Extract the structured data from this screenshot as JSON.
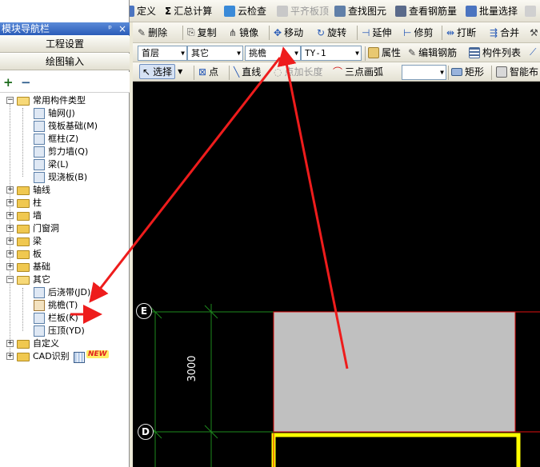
{
  "toolbar1": {
    "items": [
      {
        "label": "定义",
        "icon": "define-icon"
      },
      {
        "label": "汇总计算",
        "icon": "sum-icon"
      },
      {
        "label": "云检查",
        "icon": "cloud-check-icon"
      },
      {
        "label": "平齐板顶",
        "icon": "align-slab-top-icon"
      },
      {
        "label": "查找图元",
        "icon": "find-element-icon"
      },
      {
        "label": "查看钢筋量",
        "icon": "view-rebar-icon"
      },
      {
        "label": "批量选择",
        "icon": "batch-select-icon"
      }
    ]
  },
  "panel": {
    "title": "模块导航栏",
    "pin": "ᵖ",
    "close": "×",
    "btn_project": "工程设置",
    "btn_drawing": "绘图输入"
  },
  "tree": {
    "root": "常用构件类型",
    "common_items": [
      "轴网(J)",
      "筏板基础(M)",
      "框柱(Z)",
      "剪力墙(Q)",
      "梁(L)",
      "现浇板(B)"
    ],
    "groups": [
      "轴线",
      "柱",
      "墙",
      "门窗洞",
      "梁",
      "板",
      "基础"
    ],
    "other_group": "其它",
    "other_items": [
      "后浇带(JD)",
      "挑檐(T)",
      "栏板(K)",
      "压顶(YD)"
    ],
    "tail_groups": [
      "自定义",
      "CAD识别"
    ],
    "new_badge": "NEW"
  },
  "toolbar2": {
    "items": [
      "删除",
      "复制",
      "镜像",
      "移动",
      "旋转",
      "延伸",
      "修剪",
      "打断",
      "合并"
    ]
  },
  "toolbar3": {
    "floor": "首层",
    "category": "其它",
    "type": "挑檐",
    "name": "TY-1",
    "items": [
      "属性",
      "编辑钢筋",
      "构件列表"
    ]
  },
  "toolbar4": {
    "items": [
      "选择",
      "点",
      "直线",
      "点加长度",
      "三点画弧",
      "矩形",
      "智能布"
    ]
  },
  "canvas": {
    "axis_e": "E",
    "axis_d": "D",
    "dimension": "3000"
  },
  "colors": {
    "arrow": "#ee1c1c",
    "grid": "#1e8a1e",
    "element_fill": "#c0c0c0",
    "element_edge": "#e01010",
    "beam": "#ffff00"
  }
}
